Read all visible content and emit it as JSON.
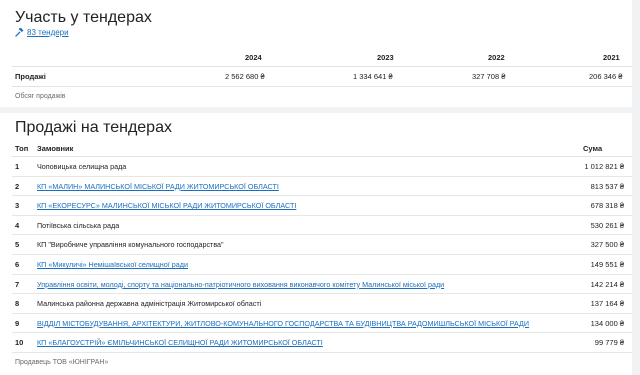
{
  "participation": {
    "title": "Участь у тендерах",
    "tenders_link": "83 тендери",
    "years": [
      "2024",
      "2023",
      "2022",
      "2021"
    ],
    "row_label": "Продажі",
    "sales": [
      "2 562 680 ₴",
      "1 334 641 ₴",
      "327 708 ₴",
      "206 346 ₴"
    ],
    "note": "Обсяг продажів"
  },
  "sales_tenders": {
    "title": "Продажі на тендерах",
    "columns": {
      "top": "Топ",
      "customer": "Замовник",
      "sum": "Сума"
    },
    "rows": [
      {
        "rank": "1",
        "customer": "Чоповицька селищна рада",
        "sum": "1 012 821 ₴",
        "link": false
      },
      {
        "rank": "2",
        "customer": "КП «МАЛИН» МАЛИНСЬКОЇ МІСЬКОЇ РАДИ ЖИТОМИРСЬКОЇ ОБЛАСТІ",
        "sum": "813 537 ₴",
        "link": true
      },
      {
        "rank": "3",
        "customer": "КП «ЕКОРЕСУРС» МАЛИНСЬКОЇ МІСЬКОЇ РАДИ ЖИТОМИРСЬКОЇ ОБЛАСТІ",
        "sum": "678 318 ₴",
        "link": true
      },
      {
        "rank": "4",
        "customer": "Потіївська сільська рада",
        "sum": "530 261 ₴",
        "link": false
      },
      {
        "rank": "5",
        "customer": "КП \"Виробниче управління комунального господарства\"",
        "sum": "327 500 ₴",
        "link": false
      },
      {
        "rank": "6",
        "customer": "КП «Микуличі» Немішаївської селищної ради",
        "sum": "149 551 ₴",
        "link": true
      },
      {
        "rank": "7",
        "customer": "Управління освіти, молоді, спорту та національно-патріотичного виховання виконавчого комітету Малинської міської ради",
        "sum": "142 214 ₴",
        "link": true
      },
      {
        "rank": "8",
        "customer": "Малинська районна державна адміністрація Житомирської області",
        "sum": "137 164 ₴",
        "link": false
      },
      {
        "rank": "9",
        "customer": "ВІДДІЛ МІСТОБУДУВАННЯ, АРХІТЕКТУРИ, ЖИТЛОВО-КОМУНАЛЬНОГО ГОСПОДАРСТВА ТА БУДІВНИЦТВА РАДОМИШЛЬСЬКОЇ МІСЬКОЇ РАДИ",
        "sum": "134 000 ₴",
        "link": true
      },
      {
        "rank": "10",
        "customer": "КП «БЛАГОУСТРІЙ» ЄМІЛЬЧИНСЬКОЇ СЕЛИЩНОЇ РАДИ ЖИТОМИРСЬКОЇ ОБЛАСТІ",
        "sum": "99 779 ₴",
        "link": true
      }
    ],
    "note": "Продавець ТОВ «ЮНІГРАН»"
  },
  "colors": {
    "link": "#1a6fc0",
    "background": "#f1f2f4",
    "card": "#ffffff"
  },
  "icons": {
    "tenders_link": "hammer-icon"
  }
}
